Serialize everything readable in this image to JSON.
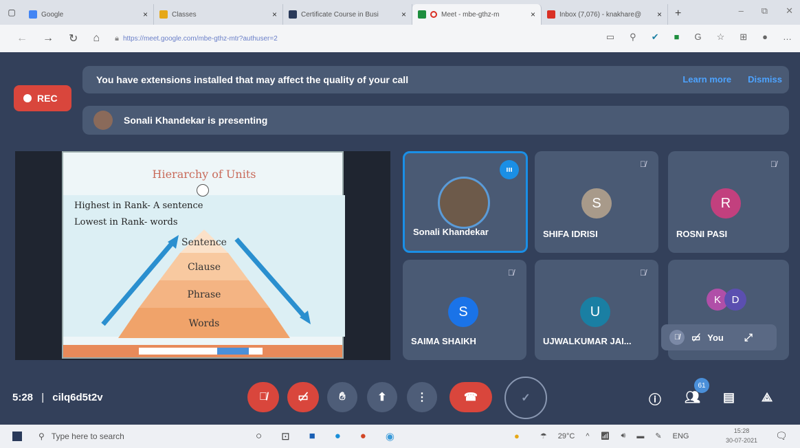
{
  "browser": {
    "tabs": [
      {
        "label": "Google",
        "icon_color": "#4285f4"
      },
      {
        "label": "Classes",
        "icon_color": "#e6a817"
      },
      {
        "label": "Certificate Course in Busi",
        "icon_color": "#2a3a5a"
      },
      {
        "label": "Meet - mbe-gthz-m",
        "icon_color": "#1e8e3e",
        "active": true
      },
      {
        "label": "Inbox (7,076) - knakhare@",
        "icon_color": "#d93025"
      }
    ],
    "new_tab": "+",
    "close": "×",
    "url": "https://meet.google.com/mbe-gthz-mtr?authuser=2",
    "window_controls": [
      "–",
      "⧉",
      "✕"
    ],
    "toolbar_icons": [
      "camera-icon",
      "extension-icon",
      "check-icon",
      "sheet-icon",
      "grammarly-icon",
      "favorites-icon",
      "collections-icon",
      "profile-icon",
      "more-icon"
    ]
  },
  "meet": {
    "rec_label": "REC",
    "extension_banner": {
      "text": "You have extensions installed that may affect the quality of your call",
      "learn_more": "Learn more",
      "dismiss": "Dismiss"
    },
    "presenting_text": "Sonali Khandekar is presenting",
    "slide": {
      "title": "Hierarchy of Units",
      "line1": "Highest in Rank- A sentence",
      "line2": "Lowest in Rank- words",
      "levels": [
        "Sentence",
        "Clause",
        "Phrase",
        "Words"
      ]
    },
    "participants": [
      {
        "name": "Sonali Khandekar",
        "initial": "",
        "color": "#6d5a4a",
        "speaking": true
      },
      {
        "name": "SHIFA IDRISI",
        "initial": "S",
        "color": "#a89a8a"
      },
      {
        "name": "ROSNI PASI",
        "initial": "R",
        "color": "#c2407e"
      },
      {
        "name": "SAIMA SHAIKH",
        "initial": "S",
        "color": "#1a73e8"
      },
      {
        "name": "UJWALKUMAR JAI...",
        "initial": "U",
        "color": "#1a7fa3"
      },
      {
        "name": "",
        "initials": [
          "K",
          "D"
        ],
        "colors": [
          "#b04fa8",
          "#5b4fb0"
        ]
      }
    ],
    "self_label": "You",
    "meeting_time": "5:28",
    "meeting_code": "cilq6d5t2v",
    "participant_count": "61"
  },
  "taskbar": {
    "search_placeholder": "Type here to search",
    "weather": "29°C",
    "lang": "ENG",
    "time": "15:28",
    "date": "30-07-2021"
  },
  "colors": {
    "meet_bg": "#33405a",
    "tile_bg": "#4a5a74",
    "red": "#d9463c",
    "blue": "#1a8fe6"
  }
}
